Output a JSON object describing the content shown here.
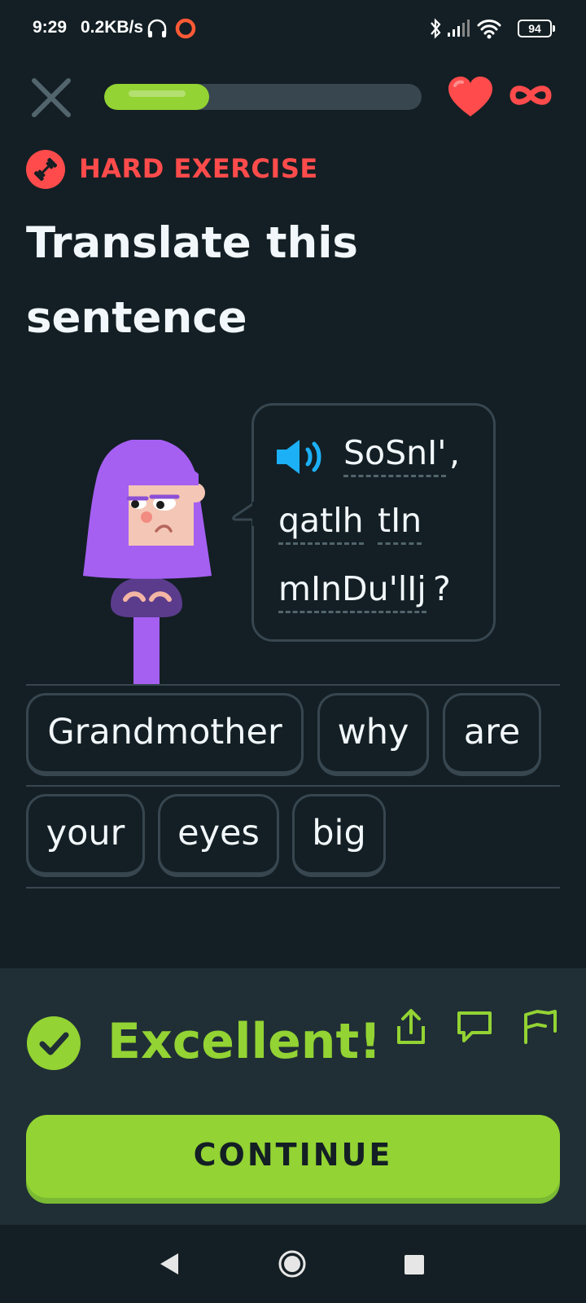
{
  "status_bar": {
    "time": "9:29",
    "speed": "0.2KB/s",
    "battery": "94",
    "icons": [
      "headset-icon",
      "circle-app-icon",
      "bluetooth-icon",
      "signal-icon",
      "wifi-icon",
      "battery-icon"
    ]
  },
  "header": {
    "progress_fraction": 0.33,
    "colors": {
      "progress": "#93d333",
      "track": "#37464f",
      "heart": "#ff4b4b"
    },
    "icons": [
      "close-icon",
      "heart-icon",
      "infinity-icon"
    ]
  },
  "exercise": {
    "badge_label": "HARD EXERCISE",
    "title_line1": "Translate this",
    "title_line2": "sentence"
  },
  "prompt": {
    "word1": "SoSnI'",
    "comma": ",",
    "word2": "qatlh",
    "word3": "tIn",
    "word4": "mInDu'lIj",
    "question_mark": "?"
  },
  "answer": {
    "row1": [
      "Grandmother",
      "why",
      "are"
    ],
    "row2": [
      "your",
      "eyes",
      "big"
    ]
  },
  "feedback": {
    "message": "Excellent!",
    "continue_label": "CONTINUE",
    "colors": {
      "accent": "#93d333",
      "panel": "#202f36"
    },
    "icons": [
      "check-icon",
      "share-icon",
      "comment-icon",
      "flag-icon"
    ]
  },
  "nav_bar": {
    "icons": [
      "back-icon",
      "home-icon",
      "recents-icon"
    ]
  }
}
